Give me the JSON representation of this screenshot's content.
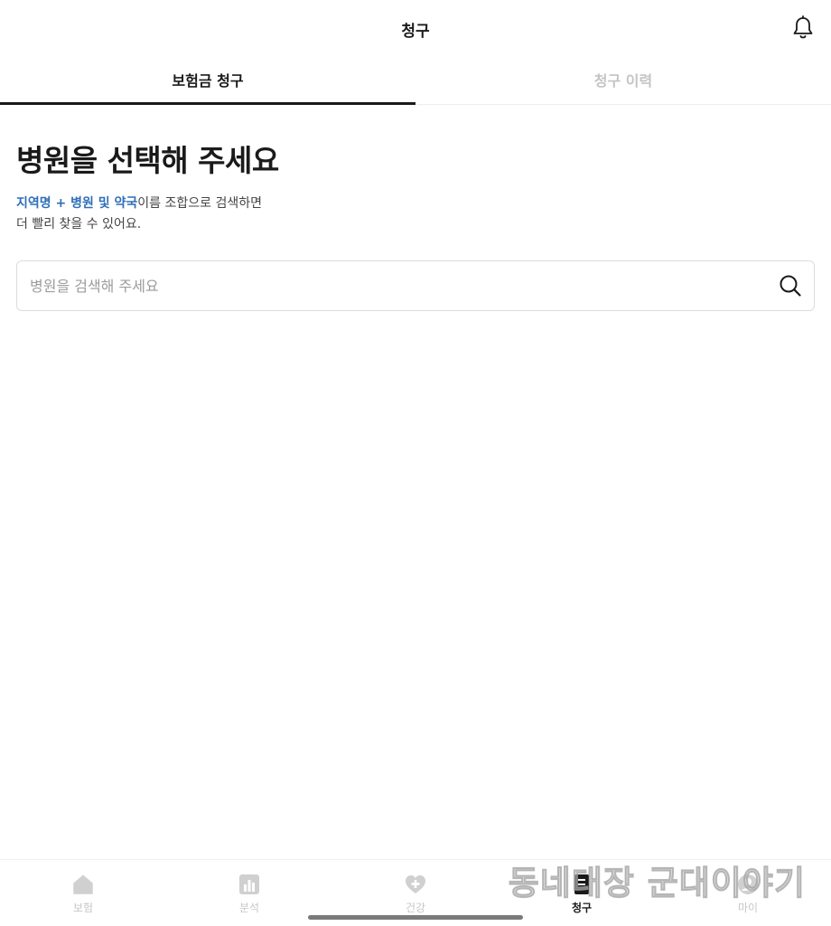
{
  "header": {
    "title": "청구",
    "bell_icon": "bell-icon"
  },
  "tabs": [
    {
      "label": "보험금 청구",
      "active": true
    },
    {
      "label": "청구 이력",
      "active": false
    }
  ],
  "main": {
    "title": "병원을 선택해 주세요",
    "desc": {
      "hl1": "지역명",
      "plus": " + ",
      "hl2": "병원 및 약국",
      "rest1": "이름 조합으로 검색하면",
      "line2": "더 빨리 찾을 수 있어요."
    },
    "search": {
      "placeholder": "병원을 검색해 주세요",
      "value": "",
      "icon": "search-icon"
    }
  },
  "bottom_nav": {
    "items": [
      {
        "label": "보험",
        "icon": "home-icon",
        "active": false
      },
      {
        "label": "분석",
        "icon": "bar-chart-icon",
        "active": false
      },
      {
        "label": "건강",
        "icon": "heart-plus-icon",
        "active": false
      },
      {
        "label": "청구",
        "icon": "claim-icon",
        "active": true
      },
      {
        "label": "마이",
        "icon": "profile-icon",
        "active": false
      }
    ]
  },
  "watermark": "동네대장 군대이야기",
  "colors": {
    "accent_link": "#2f6fb7",
    "text_primary": "#1a1a1a",
    "inactive": "#c4c4c4"
  }
}
